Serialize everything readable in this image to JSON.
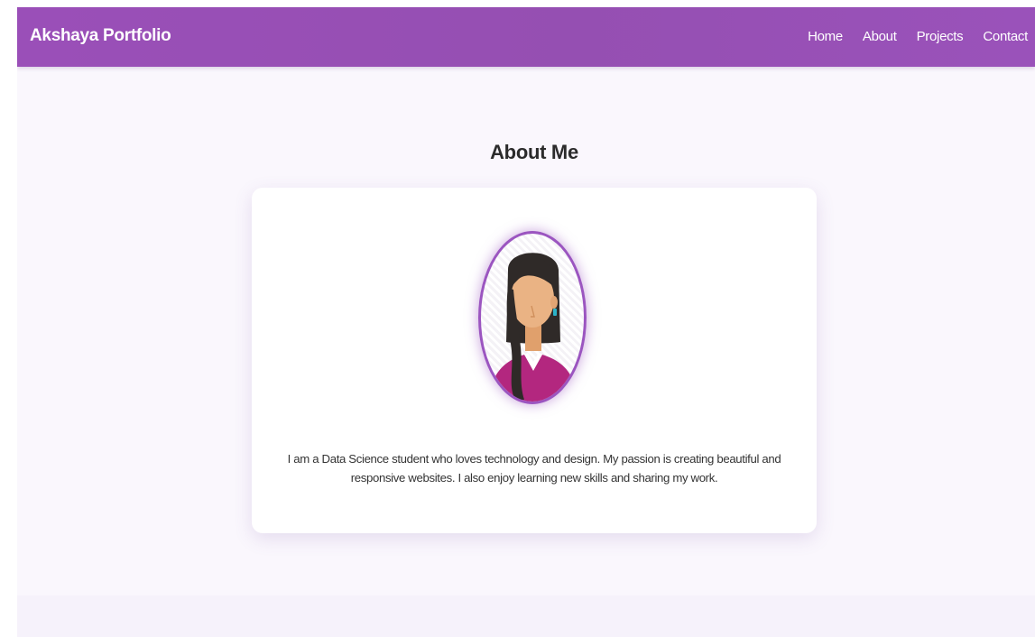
{
  "navbar": {
    "brand": "Akshaya Portfolio",
    "links": [
      "Home",
      "About",
      "Projects",
      "Contact"
    ]
  },
  "about": {
    "title": "About Me",
    "avatar_icon": "woman-avatar-icon",
    "bio": "I am a Data Science student who loves technology and design. My passion is creating beautiful and responsive websites. I also enjoy learning new skills and sharing my work."
  },
  "colors": {
    "navbar": "#954fb2",
    "accent": "#9b55c0",
    "page_background": "#faf7fd",
    "card_background": "#ffffff"
  }
}
